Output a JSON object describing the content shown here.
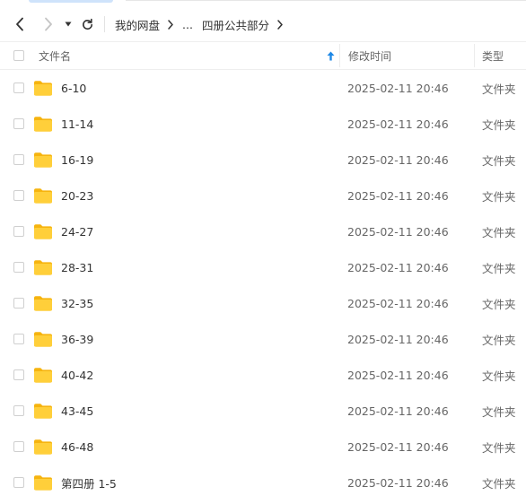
{
  "breadcrumb": {
    "root": "我的网盘",
    "ellipsis": "...",
    "current": "四册公共部分"
  },
  "header": {
    "name": "文件名",
    "modified": "修改时间",
    "type": "类型"
  },
  "files": [
    {
      "name": "6-10",
      "modified": "2025-02-11 20:46",
      "type": "文件夹"
    },
    {
      "name": "11-14",
      "modified": "2025-02-11 20:46",
      "type": "文件夹"
    },
    {
      "name": "16-19",
      "modified": "2025-02-11 20:46",
      "type": "文件夹"
    },
    {
      "name": "20-23",
      "modified": "2025-02-11 20:46",
      "type": "文件夹"
    },
    {
      "name": "24-27",
      "modified": "2025-02-11 20:46",
      "type": "文件夹"
    },
    {
      "name": "28-31",
      "modified": "2025-02-11 20:46",
      "type": "文件夹"
    },
    {
      "name": "32-35",
      "modified": "2025-02-11 20:46",
      "type": "文件夹"
    },
    {
      "name": "36-39",
      "modified": "2025-02-11 20:46",
      "type": "文件夹"
    },
    {
      "name": "40-42",
      "modified": "2025-02-11 20:46",
      "type": "文件夹"
    },
    {
      "name": "43-45",
      "modified": "2025-02-11 20:46",
      "type": "文件夹"
    },
    {
      "name": "46-48",
      "modified": "2025-02-11 20:46",
      "type": "文件夹"
    },
    {
      "name": "第四册 1-5",
      "modified": "2025-02-11 20:46",
      "type": "文件夹"
    }
  ],
  "icons": {
    "back": "chevron-left-icon",
    "forward": "chevron-right-icon",
    "history": "caret-down-icon",
    "refresh": "refresh-icon",
    "folder": "folder-icon",
    "sort": "sort-ascending-icon"
  },
  "colors": {
    "accent": "#1e88e5",
    "folder": "#ffc727"
  }
}
